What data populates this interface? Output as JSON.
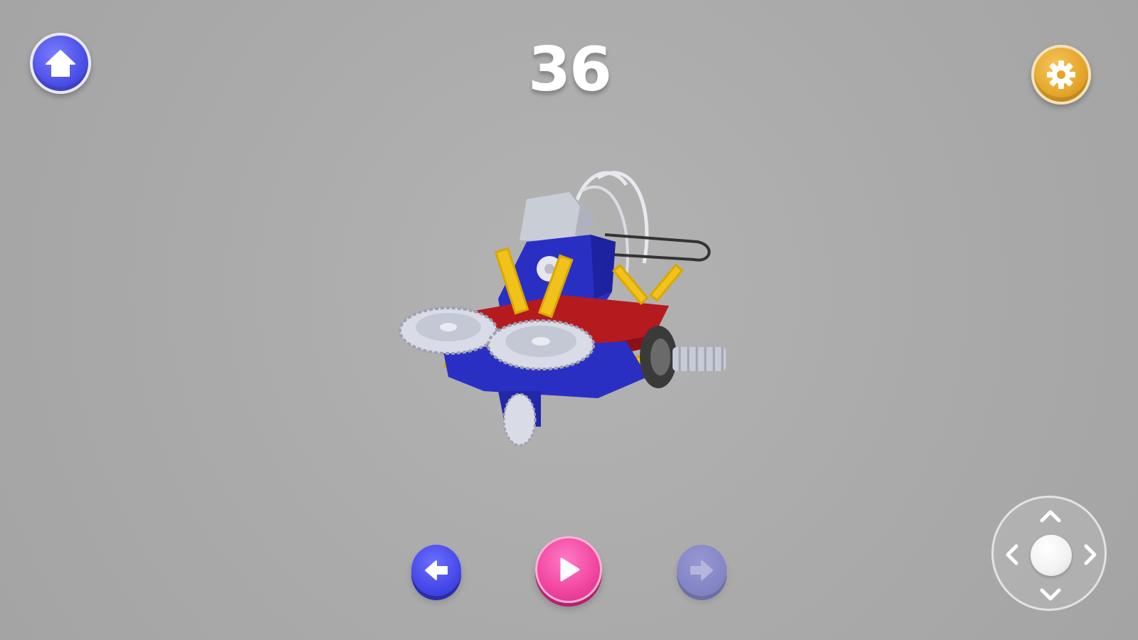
{
  "step_counter": "36",
  "colors": {
    "background": "#ababab",
    "home_button": "#4b4fe6",
    "settings_button": "#e4a42a",
    "play_button": "#f0459e",
    "prev_button": "#4346e6",
    "next_button_disabled": "#7c7ecb"
  },
  "top_bar": {
    "home_icon": "home-icon",
    "settings_icon": "gear-icon"
  },
  "controls": {
    "prev_icon": "arrow-left-icon",
    "play_icon": "play-icon",
    "next_icon": "arrow-right-icon",
    "next_enabled": false
  },
  "joystick": {
    "directions": [
      "up",
      "down",
      "left",
      "right"
    ]
  }
}
